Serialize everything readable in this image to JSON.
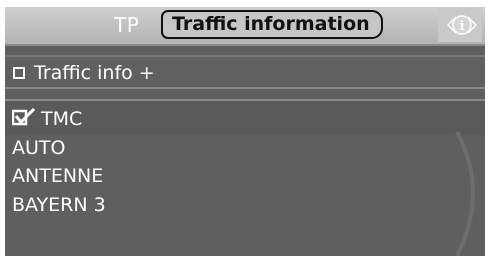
{
  "header": {
    "tab_tp": "TP",
    "tab_active": "Traffic information",
    "info_icon": "info-icon"
  },
  "menu": {
    "traffic_info_plus": {
      "label": "Traffic info +",
      "checked": false
    },
    "tmc": {
      "label": "TMC",
      "checked": true
    }
  },
  "stations": [
    "AUTO",
    "ANTENNE",
    "BAYERN 3"
  ],
  "colors": {
    "panel_bg": "#5f5f5f",
    "header_bg": "#c0c0c0",
    "active_tab_border": "#111111",
    "text": "#ffffff"
  }
}
